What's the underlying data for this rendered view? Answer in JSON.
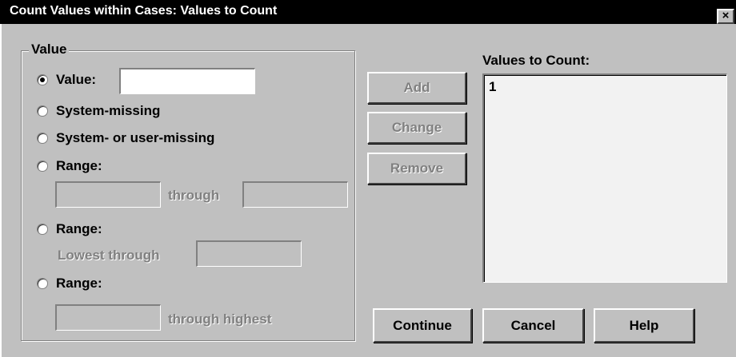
{
  "window": {
    "title": "Count Values within Cases: Values to Count",
    "close_glyph": "×"
  },
  "value_group": {
    "title": "Value",
    "options": {
      "value": {
        "label": "Value:",
        "checked": true,
        "input_value": ""
      },
      "system_missing": {
        "label": "System-missing",
        "checked": false
      },
      "system_or_user_missing": {
        "label": "System- or user-missing",
        "checked": false
      },
      "range": {
        "label": "Range:",
        "checked": false,
        "from": "",
        "through_label": "through",
        "to": ""
      },
      "range_lowest": {
        "label": "Range:",
        "checked": false,
        "lowest_through_label": "Lowest through",
        "to": ""
      },
      "range_highest": {
        "label": "Range:",
        "checked": false,
        "from": "",
        "through_highest_label": "through highest"
      }
    }
  },
  "buttons": {
    "add": "Add",
    "change": "Change",
    "remove": "Remove",
    "continue": "Continue",
    "cancel": "Cancel",
    "help": "Help"
  },
  "values_to_count": {
    "label": "Values to Count:",
    "items": [
      "1"
    ]
  }
}
